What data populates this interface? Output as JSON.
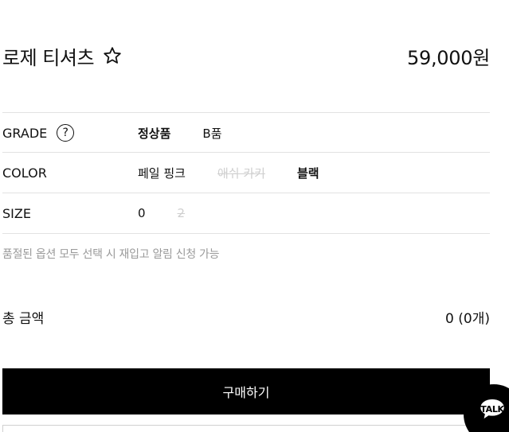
{
  "product": {
    "title": "로제 티셔츠",
    "price": "59,000원"
  },
  "options": {
    "grade": {
      "label": "GRADE",
      "help_symbol": "?",
      "values": [
        "정상품",
        "B품"
      ]
    },
    "color": {
      "label": "COLOR",
      "values": [
        "페일 핑크",
        "애쉬 카키",
        "블랙"
      ]
    },
    "size": {
      "label": "SIZE",
      "values": [
        "0",
        "2"
      ]
    }
  },
  "note": "품절된 옵션 모두 선택 시 재입고 알림 신청 가능",
  "total": {
    "label": "총 금액",
    "value": "0 (0개)"
  },
  "buy_button": {
    "label": "구매하기"
  },
  "talk": {
    "label": "TALK"
  },
  "icons": {
    "favorite": "star-outline-icon",
    "help": "question-circle-icon",
    "talk": "chat-bubble-icon"
  },
  "colors": {
    "primary": "#000000",
    "text": "#111111",
    "muted": "#9a9a9a",
    "disabled": "#cfcfcf",
    "divider": "#e2e2e2"
  }
}
